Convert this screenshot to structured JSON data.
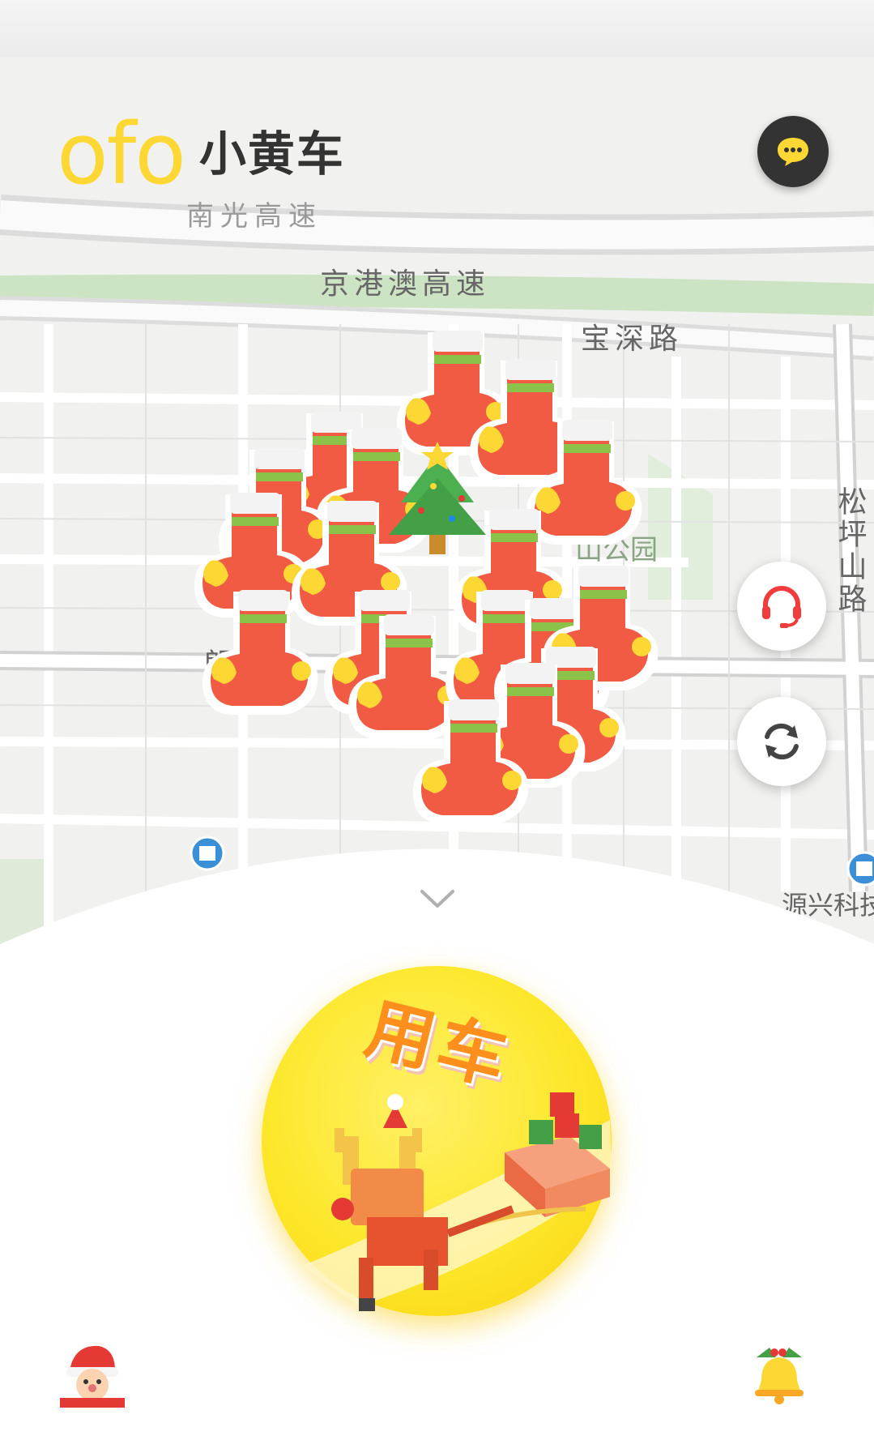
{
  "header": {
    "brand_logo": "ofo",
    "brand_name": "小黄车"
  },
  "map": {
    "road_labels": [
      "南光高速",
      "京港澳高速",
      "宝深路",
      "松坪山路",
      "山公园",
      "朗",
      "源兴科技"
    ],
    "marker_icon": "christmas-stocking-icon",
    "center_marker_icon": "christmas-tree-icon"
  },
  "controls": {
    "message_icon": "chat-bubble-icon",
    "support_icon": "headset-icon",
    "refresh_icon": "refresh-icon"
  },
  "bottom_sheet": {
    "collapse_icon": "chevron-down-icon",
    "use_bike_label": "用车",
    "left_icon": "santa-icon",
    "right_icon": "christmas-bell-icon"
  },
  "colors": {
    "brand_yellow": "#fdd835",
    "accent_red": "#f03c3c",
    "dark": "#333333"
  }
}
